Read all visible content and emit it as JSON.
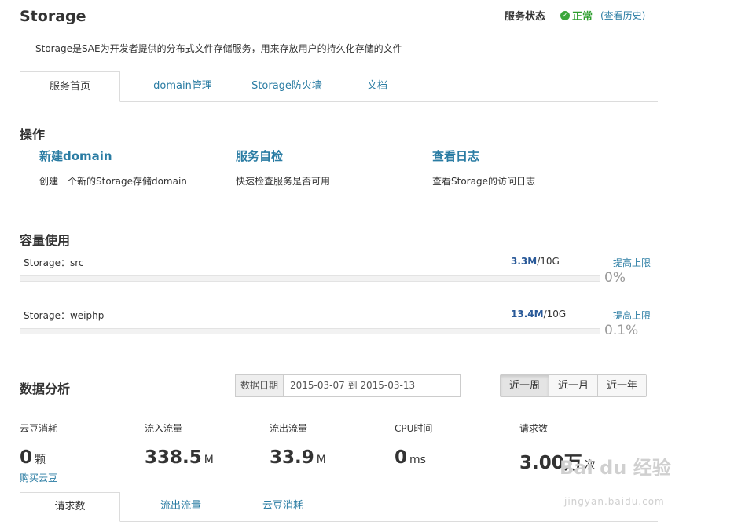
{
  "header": {
    "title": "Storage",
    "status_label": "服务状态",
    "status_value": "正常",
    "history_link": "(查看历史)",
    "description": "Storage是SAE为开发者提供的分布式文件存储服务，用来存放用户的持久化存储的文件"
  },
  "tabs": [
    {
      "label": "服务首页",
      "active": true
    },
    {
      "label": "domain管理",
      "active": false
    },
    {
      "label": "Storage防火墙",
      "active": false
    },
    {
      "label": "文档",
      "active": false
    }
  ],
  "operations": {
    "title": "操作",
    "items": [
      {
        "label": "新建domain",
        "desc": "创建一个新的Storage存储domain"
      },
      {
        "label": "服务自检",
        "desc": "快速检查服务是否可用"
      },
      {
        "label": "查看日志",
        "desc": "查看Storage的访问日志"
      }
    ]
  },
  "usage": {
    "title": "容量使用",
    "items": [
      {
        "name": "Storage：src",
        "used": "3.3M",
        "total": "/10G",
        "raise": "提高上限",
        "percent_text": "0%",
        "fraction": 0.0
      },
      {
        "name": "Storage：weiphp",
        "used": "13.4M",
        "total": "/10G",
        "raise": "提高上限",
        "percent_text": "0.1%",
        "fraction": 0.001
      }
    ]
  },
  "analysis": {
    "title": "数据分析",
    "date_label": "数据日期",
    "date_value": "2015-03-07 到 2015-03-13",
    "ranges": [
      {
        "label": "近一周",
        "active": true
      },
      {
        "label": "近一月",
        "active": false
      },
      {
        "label": "近一年",
        "active": false
      }
    ],
    "metrics": [
      {
        "label": "云豆消耗",
        "value": "0",
        "unit": "颗"
      },
      {
        "label": "流入流量",
        "value": "338.5",
        "unit": "M"
      },
      {
        "label": "流出流量",
        "value": "33.9",
        "unit": "M"
      },
      {
        "label": "CPU时间",
        "value": "0",
        "unit": "ms"
      },
      {
        "label": "请求数",
        "value": "3.00万",
        "unit": "次"
      }
    ],
    "buy_link": "购买云豆"
  },
  "bottom_tabs": [
    {
      "label": "请求数",
      "active": true
    },
    {
      "label": "流出流量",
      "active": false
    },
    {
      "label": "云豆消耗",
      "active": false
    }
  ],
  "watermark": {
    "logo": "Bai du 经验",
    "url": "jingyan.baidu.com"
  },
  "colors": {
    "link": "#2a7ca3",
    "ok": "#3aa63a"
  }
}
